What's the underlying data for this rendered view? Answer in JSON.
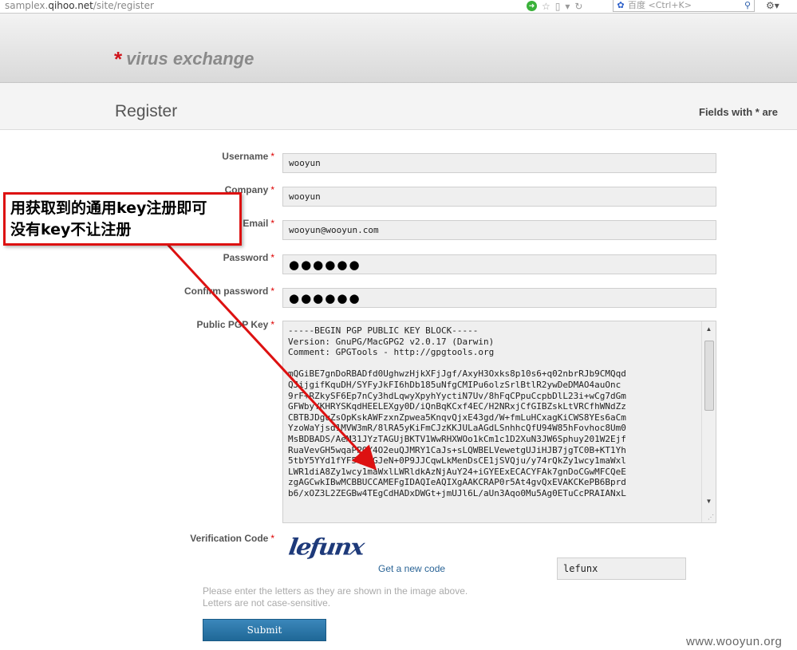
{
  "browser": {
    "url_prefix": "samplex.",
    "url_domain": "qihoo.net",
    "url_path": "/site/register",
    "search_placeholder": "百度 <Ctrl+K>"
  },
  "header": {
    "logo_mark": "*",
    "logo_text": "virus exchange"
  },
  "page": {
    "title": "Register",
    "fields_note": "Fields with * are"
  },
  "form": {
    "required_mark": "*",
    "username": {
      "label": "Username",
      "value": "wooyun"
    },
    "company": {
      "label": "Company",
      "value": "wooyun"
    },
    "email": {
      "label": "Email",
      "value": "wooyun@wooyun.com"
    },
    "password": {
      "label": "Password",
      "value": "●●●●●●"
    },
    "confirm_password": {
      "label": "Confirm password",
      "value": "●●●●●●"
    },
    "pgp_key": {
      "label": "Public PGP Key",
      "value": "-----BEGIN PGP PUBLIC KEY BLOCK-----\nVersion: GnuPG/MacGPG2 v2.0.17 (Darwin)\nComment: GPGTools - http://gpgtools.org\n\nmQGiBE7gnDoRBADfd0UghwzHjkXFjJgf/AxyH3Oxks8p10s6+q02nbrRJb9CMQqd\nQJijgifKquDH/SYFyJkFI6hDb185uNfgCMIPu6olzSrlBtlR2ywDeDMAO4auOnc\n9rF+RZkySF6Ep7nCy3hdLqwyXpyhYyctiN7Uv/8hFqCPpuCcpbDlL23i+wCg7dGm\nGFWbyYKHRYSKqdHEELEXgy0D/iQnBqKCxf4EC/H2NRxjCfGIBZskLtVRCfhWNdZz\nCBTBJDguZsOpKskAWFzxnZpwea5KnqvQjxE43gd/W+fmLuHCxagKiCWS8YEs6aCm\nYzoWaYjsd1MVW3mR/8lRA5yKiFmCJzKKJULaAGdLSnhhcQfU94W85hFovhoc8Um0\nMsBDBADS/AeM31JYzTAGUjBKTV1WwRHXWOo1kCm1c1D2XuN3JW6Sphuy201W2Ejf\nRuaVevGH5wqaPP0Y4O2euQJMRY1CaJs+sLQWBELVewetgUJiHJB7jgTC0B+KT1Yh\n5tbY5YYd1fYF5QthGJeN+0P9JJCqwLkMenDsCE1jSVQju/y74rQkZy1wcy1maWxl\nLWR1diA8Zy1wcy1maWxlLWRldkAzNjAuY24+iGYEExECACYFAk7gnDoCGwMFCQeE\nzgAGCwkIBwMCBBUCCAMEFgIDAQIeAQIXgAAKCRAP0r5At4gvQxEVAKCKePB6Bprd\nb6/xOZ3L2ZEGBw4TEgCdHADxDWGt+jmUJl6L/aUn3Aqo0Mu5Ag0ETuCcPRAIANxL"
    },
    "verification": {
      "label": "Verification Code",
      "captcha_text": "lefunx",
      "new_code_link": "Get a new code",
      "value": "lefunx",
      "hint_line1": "Please enter the letters as they are shown in the image above.",
      "hint_line2": "Letters are not case-sensitive."
    },
    "submit_label": "Submit"
  },
  "annotation": {
    "line1": "用获取到的通用key注册即可",
    "line2": "没有key不让注册",
    "color": "#dd1111"
  },
  "watermark": "www.wooyun.org"
}
